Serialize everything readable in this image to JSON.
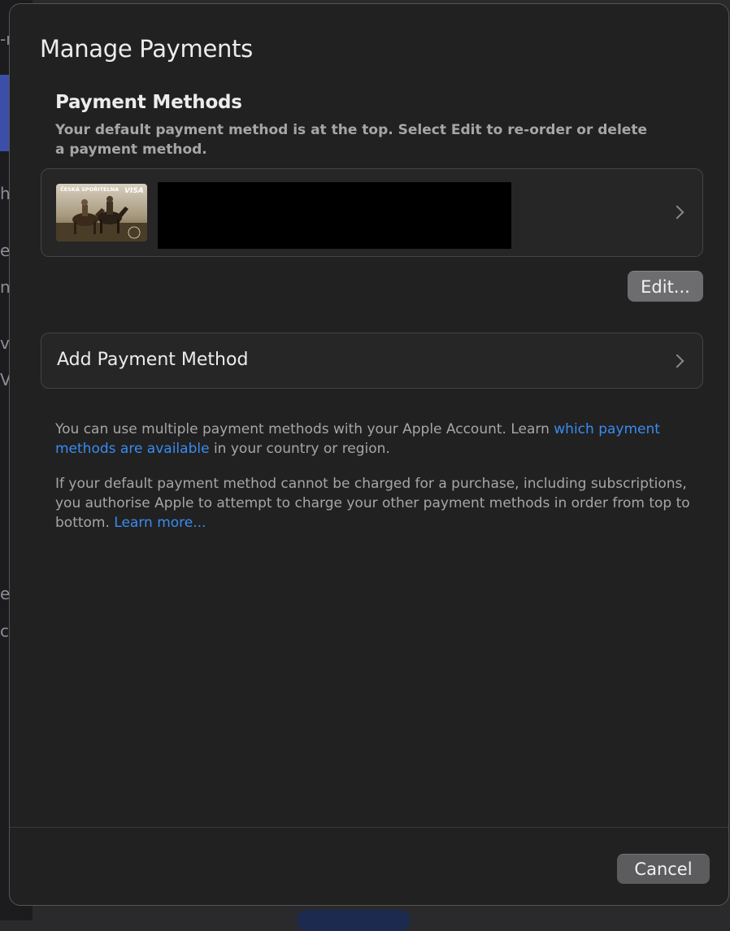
{
  "background_window": {
    "fragments": [
      "-n",
      "h",
      "e",
      "n",
      "v",
      "V",
      "e",
      "c"
    ]
  },
  "sheet": {
    "title": "Manage Payments",
    "payment_methods": {
      "heading": "Payment Methods",
      "description": "Your default payment method is at the top. Select Edit to re-order or delete a payment method.",
      "cards": [
        {
          "brand": "VISA",
          "issuer_text": "ČESKÁ SPOŘITELNA",
          "details_redacted": true
        }
      ],
      "edit_label": "Edit..."
    },
    "add_payment": {
      "label": "Add Payment Method"
    },
    "info": {
      "p1_before": "You can use multiple payment methods with your Apple Account. Learn ",
      "p1_link": "which payment methods are available",
      "p1_after": " in your country or region.",
      "p2_before": "If your default payment method cannot be charged for a purchase, including subscriptions, you authorise Apple to attempt to charge your other payment methods in order from top to bottom. ",
      "p2_link": "Learn more..."
    },
    "cancel_label": "Cancel"
  },
  "colors": {
    "sheet_bg": "#212121",
    "link": "#3a8bf0",
    "row_border": "#444444"
  }
}
